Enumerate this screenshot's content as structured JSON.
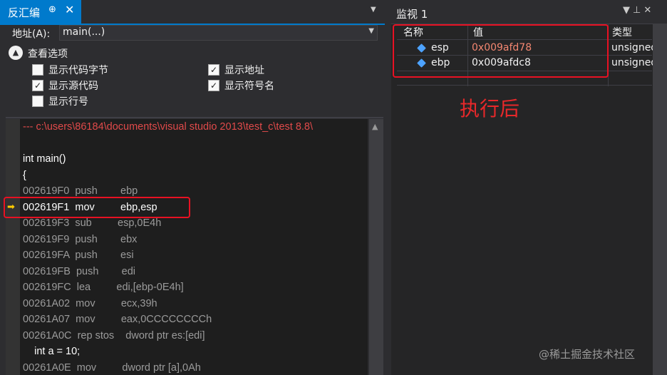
{
  "disassembly": {
    "tab_title": "反汇编",
    "pin_icon": "⊕",
    "close_icon": "✕",
    "address_label": "地址(A):",
    "address_value": "main(...)",
    "options_title": "查看选项",
    "options": [
      {
        "label": "显示代码字节",
        "checked": false
      },
      {
        "label": "显示地址",
        "checked": true
      },
      {
        "label": "显示源代码",
        "checked": true
      },
      {
        "label": "显示符号名",
        "checked": true
      },
      {
        "label": "显示行号",
        "checked": false
      }
    ],
    "lines": [
      "--- c:\\users\\86184\\documents\\visual studio 2013\\test_c\\test 8.8\\",
      "",
      "int main()",
      "{",
      "002619F0  push        ebp",
      "002619F1  mov         ebp,esp",
      "002619F3  sub         esp,0E4h",
      "002619F9  push        ebx",
      "002619FA  push        esi",
      "002619FB  push        edi",
      "002619FC  lea         edi,[ebp-0E4h]",
      "00261A02  mov         ecx,39h",
      "00261A07  mov         eax,0CCCCCCCCh",
      "00261A0C  rep stos    dword ptr es:[edi]",
      "    int a = 10;",
      "00261A0E  mov         dword ptr [a],0Ah"
    ]
  },
  "watch": {
    "title": "监视 1",
    "columns": [
      "名称",
      "值",
      "类型"
    ],
    "rows": [
      {
        "name": "esp",
        "value": "0x009afd78",
        "type": "unsigned"
      },
      {
        "name": "ebp",
        "value": "0x009afdc8",
        "type": "unsigned"
      }
    ],
    "value_color": "#f48771"
  },
  "annotation": "执行后",
  "watermark": "@稀土掘金技术社区"
}
